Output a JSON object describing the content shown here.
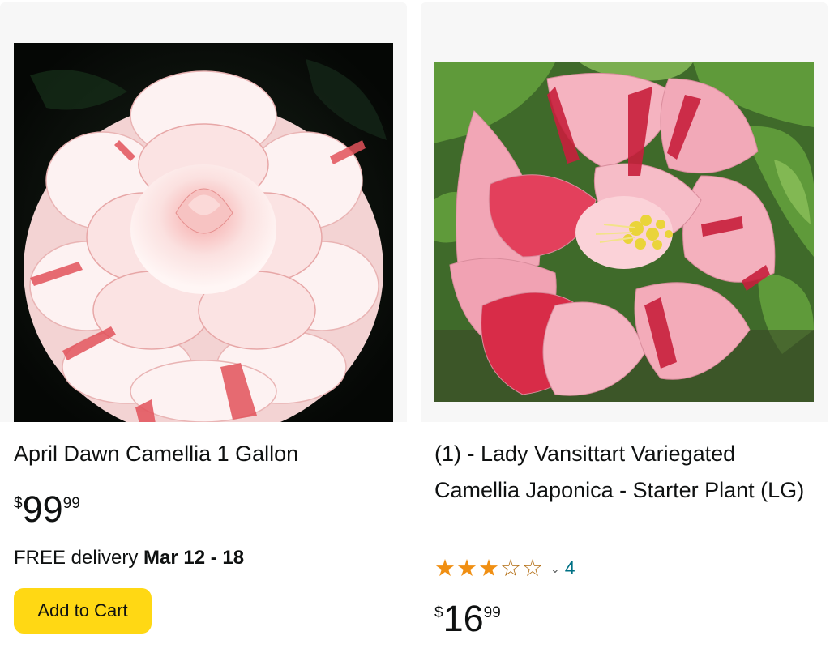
{
  "products": [
    {
      "title": "April Dawn Camellia 1 Gallon",
      "image_alt": "",
      "price": {
        "symbol": "$",
        "whole": "99",
        "fraction": "99"
      },
      "delivery": {
        "prefix": "FREE delivery ",
        "date": "Mar 12 - 18"
      },
      "add_to_cart_label": "Add to Cart"
    },
    {
      "title": "(1) - Lady Vansittart Variegated Camellia Japonica - Starter Plant (LG)",
      "image_alt": "",
      "rating": {
        "stars": 3,
        "max": 5,
        "count": "4"
      },
      "price": {
        "symbol": "$",
        "whole": "16",
        "fraction": "99"
      }
    }
  ],
  "colors": {
    "cart_button": "#ffd814",
    "star": "#f08f13",
    "review_link": "#007185",
    "card_bg": "#f7f7f7"
  },
  "icons": [
    "star-full-icon",
    "star-empty-icon",
    "chevron-down-icon"
  ]
}
